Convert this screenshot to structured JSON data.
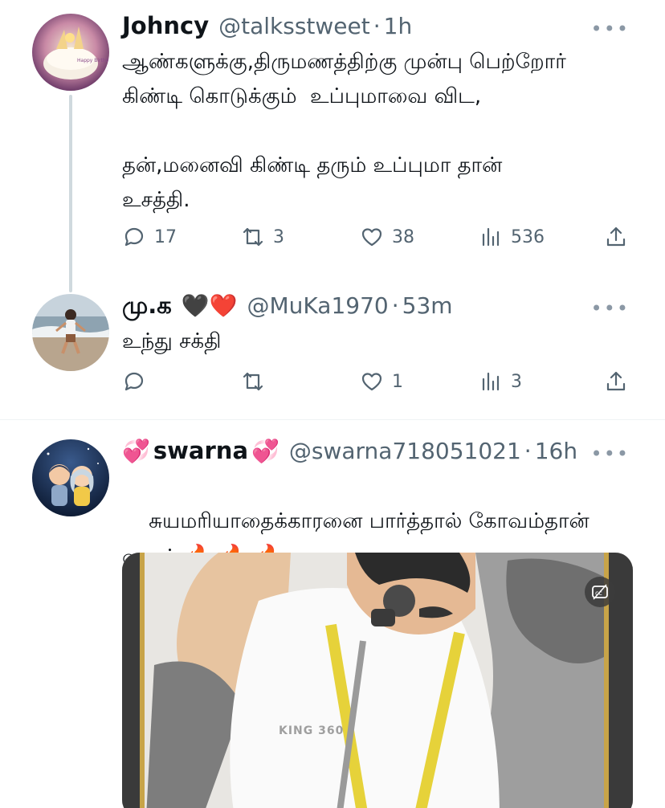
{
  "tweets": [
    {
      "name": "Johncy",
      "handle": "@talksstweet",
      "time": "1h",
      "text": "ஆண்களுக்கு,திருமணத்திற்கு முன்பு பெற்றோர்\nகிண்டி கொடுக்கும்  உப்புமாவை விட,\n\nதன்,மனைவி கிண்டி தரும் உப்புமா தான்\nஉசத்தி.",
      "replies": "17",
      "retweets": "3",
      "likes": "38",
      "views": "536"
    },
    {
      "name": "மு.க",
      "name_emoji": "🖤❤️",
      "handle": "@MuKa1970",
      "time": "53m",
      "text": "உந்து சக்தி",
      "replies": "",
      "retweets": "",
      "likes": "1",
      "views": "3"
    },
    {
      "name": "swarna",
      "name_emoji_left": "💞",
      "name_emoji_right": "💞",
      "handle": "@swarna718051021",
      "time": "16h",
      "text": "சுயமரியாதைக்காரனை பார்த்தால் கோவம்தான்\nவரும்",
      "text_emoji": "🔥 🔥 🔥",
      "media_watermark": "KING 360"
    }
  ],
  "separator": "·",
  "more_label": "•••",
  "icons": [
    "reply-icon",
    "retweet-icon",
    "like-icon",
    "views-icon",
    "share-icon",
    "more-icon",
    "captions-icon"
  ],
  "colors": {
    "text": "#0f1419",
    "secondary": "#536471",
    "divider": "#eff3f4",
    "thread_line": "#cfd9de"
  }
}
